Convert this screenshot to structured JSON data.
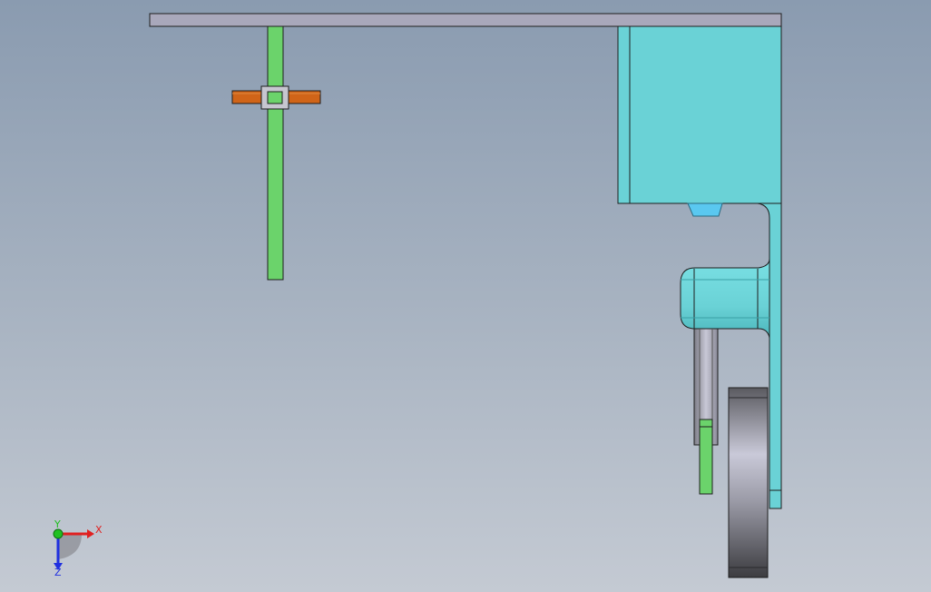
{
  "viewport": {
    "name": "graphics-area"
  },
  "model": {
    "parts": [
      "top-plate",
      "vertical-post",
      "cross-bar",
      "clamp-block",
      "housing-block",
      "side-bracket",
      "arm-bracket",
      "guide-rod",
      "small-pin",
      "wheel"
    ],
    "colors": {
      "top_plate": "#a7a7b8",
      "post": "#6bd36b",
      "cross_bar": "#d06418",
      "housing": "#6ad2d6",
      "wheel_dark": "#4a4a4e",
      "wheel_light": "#c9c9d6",
      "edge": "#1e1e1e"
    }
  },
  "triad": {
    "x_label": "X",
    "y_label": "Y",
    "z_label": "Z",
    "colors": {
      "x": "#e02020",
      "y": "#20c020",
      "z": "#2030e0"
    }
  }
}
